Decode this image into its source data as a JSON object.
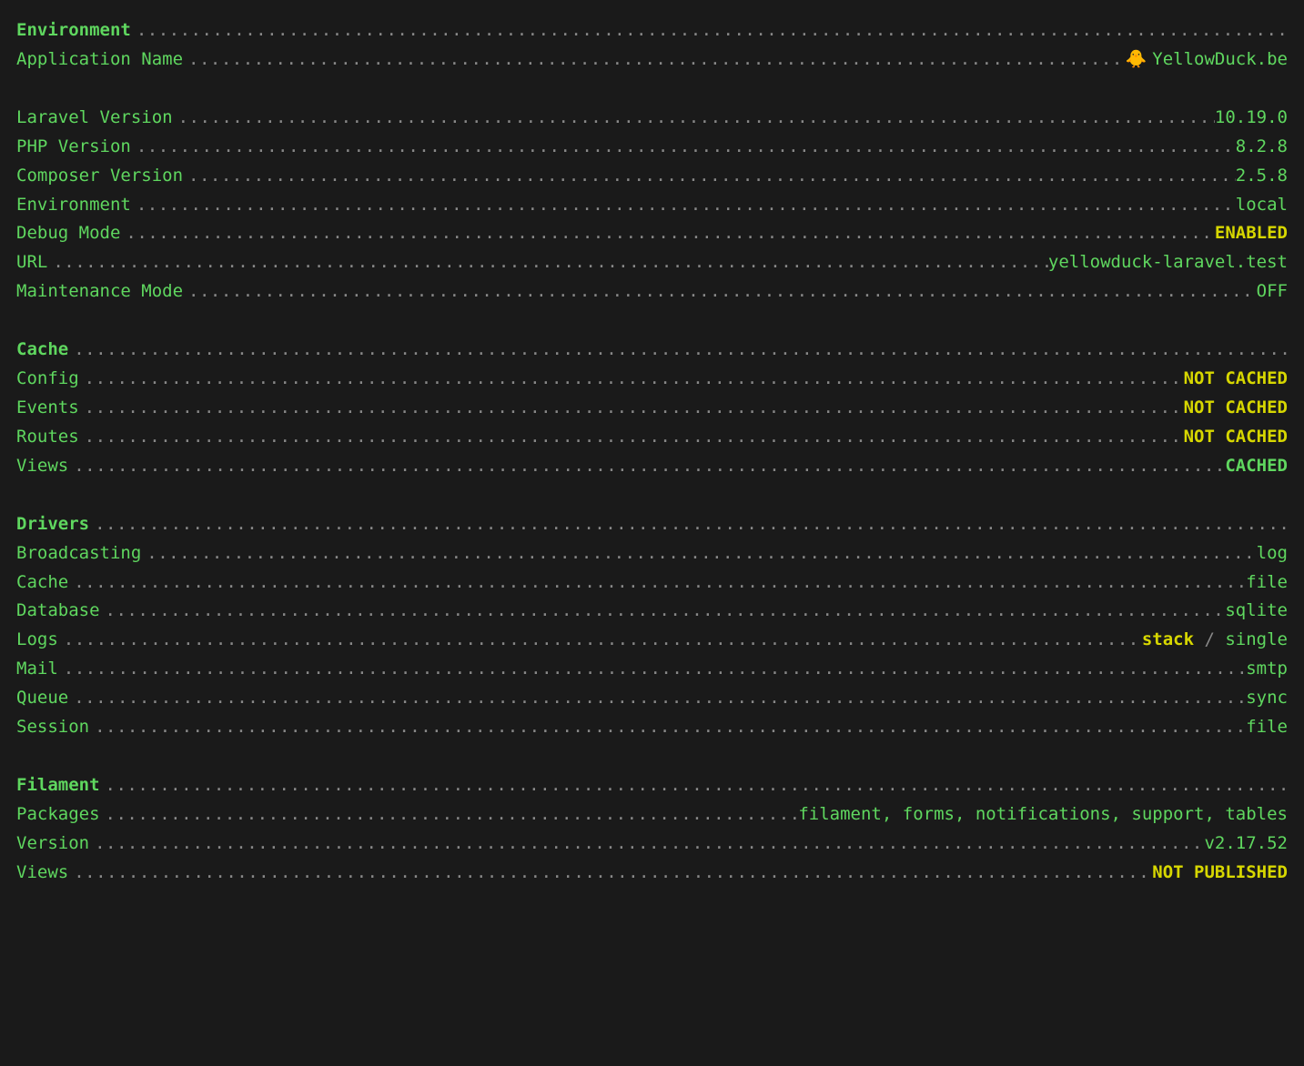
{
  "sections": {
    "environment": {
      "header": "Environment",
      "app_name_label": "Application Name",
      "app_name_icon": "🐥",
      "app_name_value": "YellowDuck.be",
      "laravel_label": "Laravel Version",
      "laravel_value": "10.19.0",
      "php_label": "PHP Version",
      "php_value": "8.2.8",
      "composer_label": "Composer Version",
      "composer_value": "2.5.8",
      "env_label": "Environment",
      "env_value": "local",
      "debug_label": "Debug Mode",
      "debug_value": "ENABLED",
      "url_label": "URL",
      "url_value": "yellowduck-laravel.test",
      "maintenance_label": "Maintenance Mode",
      "maintenance_value": "OFF"
    },
    "cache": {
      "header": "Cache",
      "config_label": "Config",
      "config_value": "NOT CACHED",
      "events_label": "Events",
      "events_value": "NOT CACHED",
      "routes_label": "Routes",
      "routes_value": "NOT CACHED",
      "views_label": "Views",
      "views_value": "CACHED"
    },
    "drivers": {
      "header": "Drivers",
      "broadcasting_label": "Broadcasting",
      "broadcasting_value": "log",
      "cache_label": "Cache",
      "cache_value": "file",
      "database_label": "Database",
      "database_value": "sqlite",
      "logs_label": "Logs",
      "logs_primary": "stack",
      "logs_sep": " / ",
      "logs_secondary": "single",
      "mail_label": "Mail",
      "mail_value": "smtp",
      "queue_label": "Queue",
      "queue_value": "sync",
      "session_label": "Session",
      "session_value": "file"
    },
    "filament": {
      "header": "Filament",
      "packages_label": "Packages",
      "packages_value": "filament, forms, notifications, support, tables",
      "version_label": "Version",
      "version_value": "v2.17.52",
      "views_label": "Views",
      "views_value": "NOT PUBLISHED"
    }
  }
}
